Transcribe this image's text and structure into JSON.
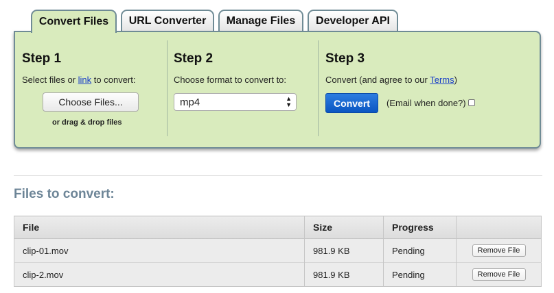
{
  "tabs": [
    {
      "label": "Convert Files",
      "active": true
    },
    {
      "label": "URL Converter",
      "active": false
    },
    {
      "label": "Manage Files",
      "active": false
    },
    {
      "label": "Developer API",
      "active": false
    }
  ],
  "step1": {
    "title": "Step 1",
    "desc_prefix": "Select files or ",
    "link": "link",
    "desc_suffix": " to convert:",
    "choose_button": "Choose Files...",
    "drag_note": "or drag & drop files"
  },
  "step2": {
    "title": "Step 2",
    "desc": "Choose format to convert to:",
    "format_selected": "mp4"
  },
  "step3": {
    "title": "Step 3",
    "desc_prefix": "Convert (and agree to our ",
    "terms_link": "Terms",
    "desc_suffix": ")",
    "convert_button": "Convert",
    "email_label": "(Email when done?)",
    "email_checked": false
  },
  "files": {
    "title": "Files to convert:",
    "columns": [
      "File",
      "Size",
      "Progress",
      ""
    ],
    "rows": [
      {
        "file": "clip-01.mov",
        "size": "981.9 KB",
        "progress": "Pending",
        "action": "Remove File"
      },
      {
        "file": "clip-2.mov",
        "size": "981.9 KB",
        "progress": "Pending",
        "action": "Remove File"
      }
    ]
  },
  "colors": {
    "panel_bg": "#d9ebbd",
    "tab_border": "#6f8b95",
    "convert_button": "#1565d0",
    "files_title": "#6d8597",
    "link": "#1a3fc7"
  }
}
